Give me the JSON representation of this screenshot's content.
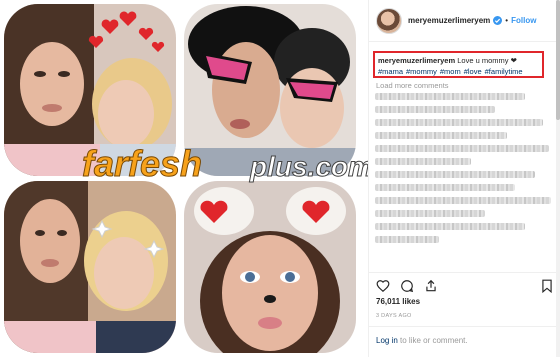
{
  "header": {
    "username": "meryemuzerlimeryem",
    "separator": "•",
    "follow_label": "Follow"
  },
  "caption": {
    "username": "meryemuzerlimeryem",
    "text": "Love u mommy ❤",
    "hashtags": [
      "#mama",
      "#mommy",
      "#mom",
      "#love",
      "#familytime"
    ]
  },
  "load_more_label": "Load more comments",
  "likes_text": "76,011 likes",
  "date_text": "3 DAYS AGO",
  "login": {
    "link_label": "Log in",
    "text": " to like or comment."
  },
  "watermark": {
    "brand": "farfesh",
    "suffix": "plus.com"
  },
  "colors": {
    "accent": "#3897f0",
    "highlight_box": "#e0262b",
    "hashtag": "#003569",
    "watermark_orange": "#f7a21b"
  },
  "icons": {
    "verified": "verified-badge-icon",
    "like": "heart-outline-icon",
    "comment": "comment-bubble-icon",
    "share": "share-icon",
    "save": "bookmark-icon"
  }
}
